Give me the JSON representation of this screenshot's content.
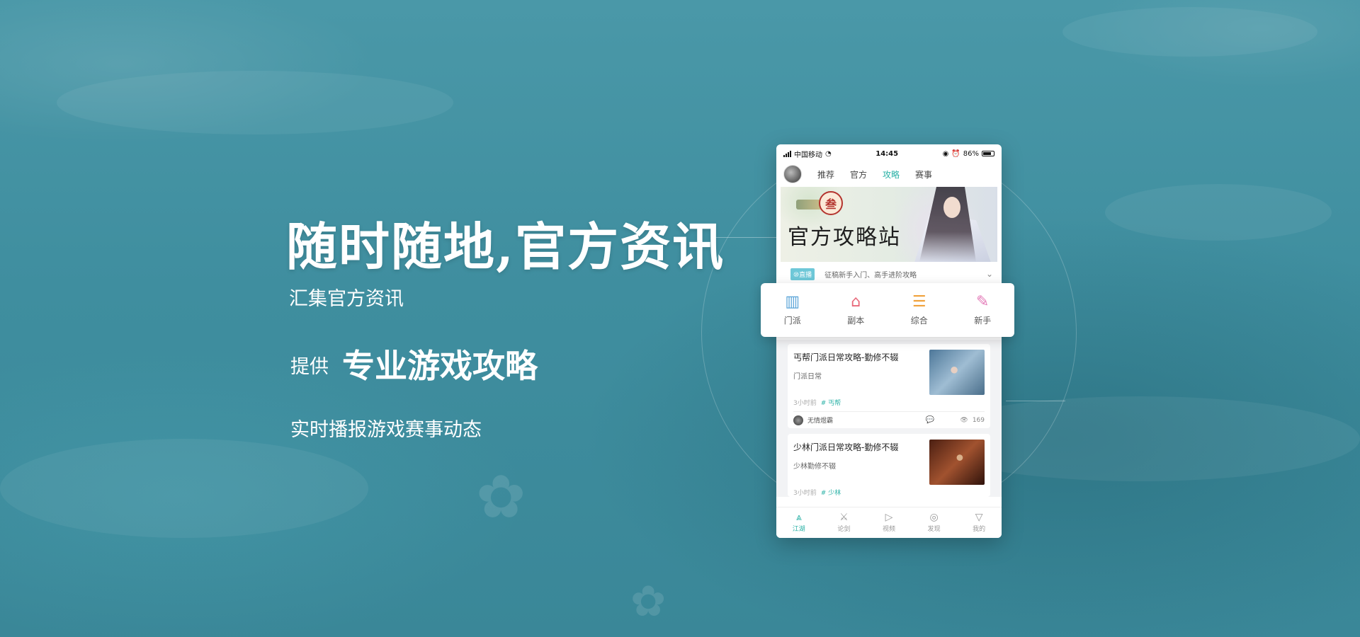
{
  "hero": {
    "headline": "随时随地,官方资讯",
    "line1": "汇集官方资讯",
    "provide_prefix": "提供",
    "provide_highlight": "专业游戏攻略",
    "line3": "实时播报游戏赛事动态"
  },
  "phone": {
    "status": {
      "carrier": "中国移动",
      "time": "14:45",
      "battery": "86%"
    },
    "tabs": [
      {
        "label": "推荐",
        "active": false
      },
      {
        "label": "官方",
        "active": false
      },
      {
        "label": "攻略",
        "active": true
      },
      {
        "label": "赛事",
        "active": false
      }
    ],
    "banner": {
      "title": "官方攻略站",
      "seal": "叁"
    },
    "notice": {
      "badge": "⑩直播",
      "text": "征稿新手入门、高手进阶攻略"
    },
    "categories": [
      {
        "label": "门派",
        "icon": "sect-icon",
        "color": "#5aa4d8"
      },
      {
        "label": "副本",
        "icon": "dungeon-icon",
        "color": "#e8697a"
      },
      {
        "label": "综合",
        "icon": "general-icon",
        "color": "#f0a23c"
      },
      {
        "label": "新手",
        "icon": "novice-icon",
        "color": "#e37bb8"
      }
    ],
    "articles": [
      {
        "title": "丐帮门派日常攻略-勤修不辍",
        "desc": "门派日常",
        "time": "3小时前",
        "tag": "# 丐帮",
        "author": "无情煜霸",
        "views": "169"
      },
      {
        "title": "少林门派日常攻略-勤修不辍",
        "desc": "少林勤修不辍",
        "time": "3小时前",
        "tag": "# 少林"
      }
    ],
    "bottom_nav": [
      {
        "label": "江湖",
        "icon": "jianghu-icon",
        "active": true
      },
      {
        "label": "论剑",
        "icon": "lunjian-icon",
        "active": false
      },
      {
        "label": "视频",
        "icon": "video-icon",
        "active": false
      },
      {
        "label": "发现",
        "icon": "discover-icon",
        "active": false
      },
      {
        "label": "我的",
        "icon": "me-icon",
        "active": false
      }
    ]
  },
  "colors": {
    "background": "#3f8e9f",
    "accent": "#2ab1a6"
  }
}
